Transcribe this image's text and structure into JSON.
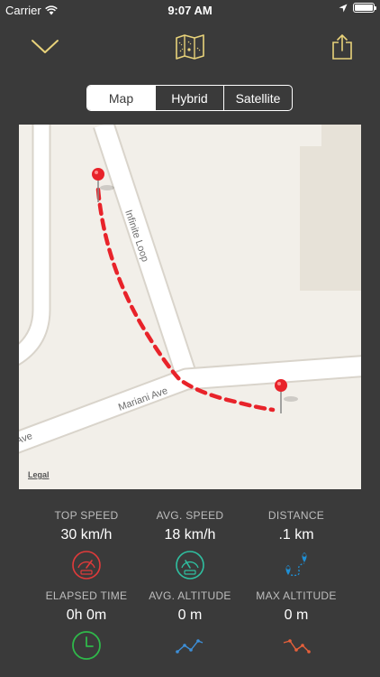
{
  "status": {
    "carrier": "Carrier",
    "time": "9:07 AM"
  },
  "toolbar": {
    "dismiss_icon": "chevron-down-icon",
    "center_icon": "map-icon",
    "share_icon": "share-icon",
    "accent": "#e8d27a"
  },
  "map_type": {
    "options": [
      "Map",
      "Hybrid",
      "Satellite"
    ],
    "selected": "Map"
  },
  "map": {
    "streets": [
      "Infinite Loop",
      "Mariani Ave",
      "Ave"
    ],
    "legal": "Legal",
    "route_color": "#e8232a"
  },
  "stats": [
    {
      "label": "TOP SPEED",
      "value": "30 km/h",
      "icon": "speedometer-icon",
      "color": "#e03a3a"
    },
    {
      "label": "AVG. SPEED",
      "value": "18 km/h",
      "icon": "speedometer-icon",
      "color": "#2fbfa0"
    },
    {
      "label": "DISTANCE",
      "value": ".1 km",
      "icon": "route-pins-icon",
      "color": "#1f8fd4"
    },
    {
      "label": "ELAPSED TIME",
      "value": "0h 0m",
      "icon": "clock-icon",
      "color": "#2fb84a"
    },
    {
      "label": "AVG. ALTITUDE",
      "value": "0 m",
      "icon": "line-graph-icon",
      "color": "#3d8fd8"
    },
    {
      "label": "MAX ALTITUDE",
      "value": "0 m",
      "icon": "line-graph-icon",
      "color": "#e8603a"
    }
  ]
}
